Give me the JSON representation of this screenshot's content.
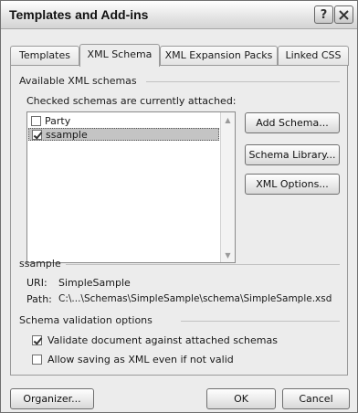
{
  "window": {
    "title": "Templates and Add-ins",
    "help_glyph": "?",
    "close_glyph": "✕"
  },
  "tabs": [
    {
      "label": "Templates",
      "active": false
    },
    {
      "label": "XML Schema",
      "active": true
    },
    {
      "label": "XML Expansion Packs",
      "active": false
    },
    {
      "label": "Linked CSS",
      "active": false
    }
  ],
  "available": {
    "group_label": "Available XML schemas",
    "list_caption": "Checked schemas are currently attached:",
    "items": [
      {
        "label": "Party",
        "checked": false,
        "selected": false
      },
      {
        "label": "ssample",
        "checked": true,
        "selected": true
      }
    ],
    "scroll_up_glyph": "▲",
    "scroll_down_glyph": "▼"
  },
  "buttons": {
    "add_schema": "Add Schema...",
    "schema_library": "Schema Library...",
    "xml_options": "XML Options...",
    "organizer": "Organizer...",
    "ok": "OK",
    "cancel": "Cancel"
  },
  "selected_schema": {
    "group_label": "ssample",
    "uri_label": "URI:",
    "uri_value": "SimpleSample",
    "path_label": "Path:",
    "path_value": "C:\\...\\Schemas\\SimpleSample\\schema\\SimpleSample.xsd"
  },
  "validation": {
    "group_label": "Schema validation options",
    "validate_label": "Validate document against attached schemas",
    "validate_checked": true,
    "allow_invalid_label": "Allow saving as XML even if not valid",
    "allow_invalid_checked": false
  }
}
